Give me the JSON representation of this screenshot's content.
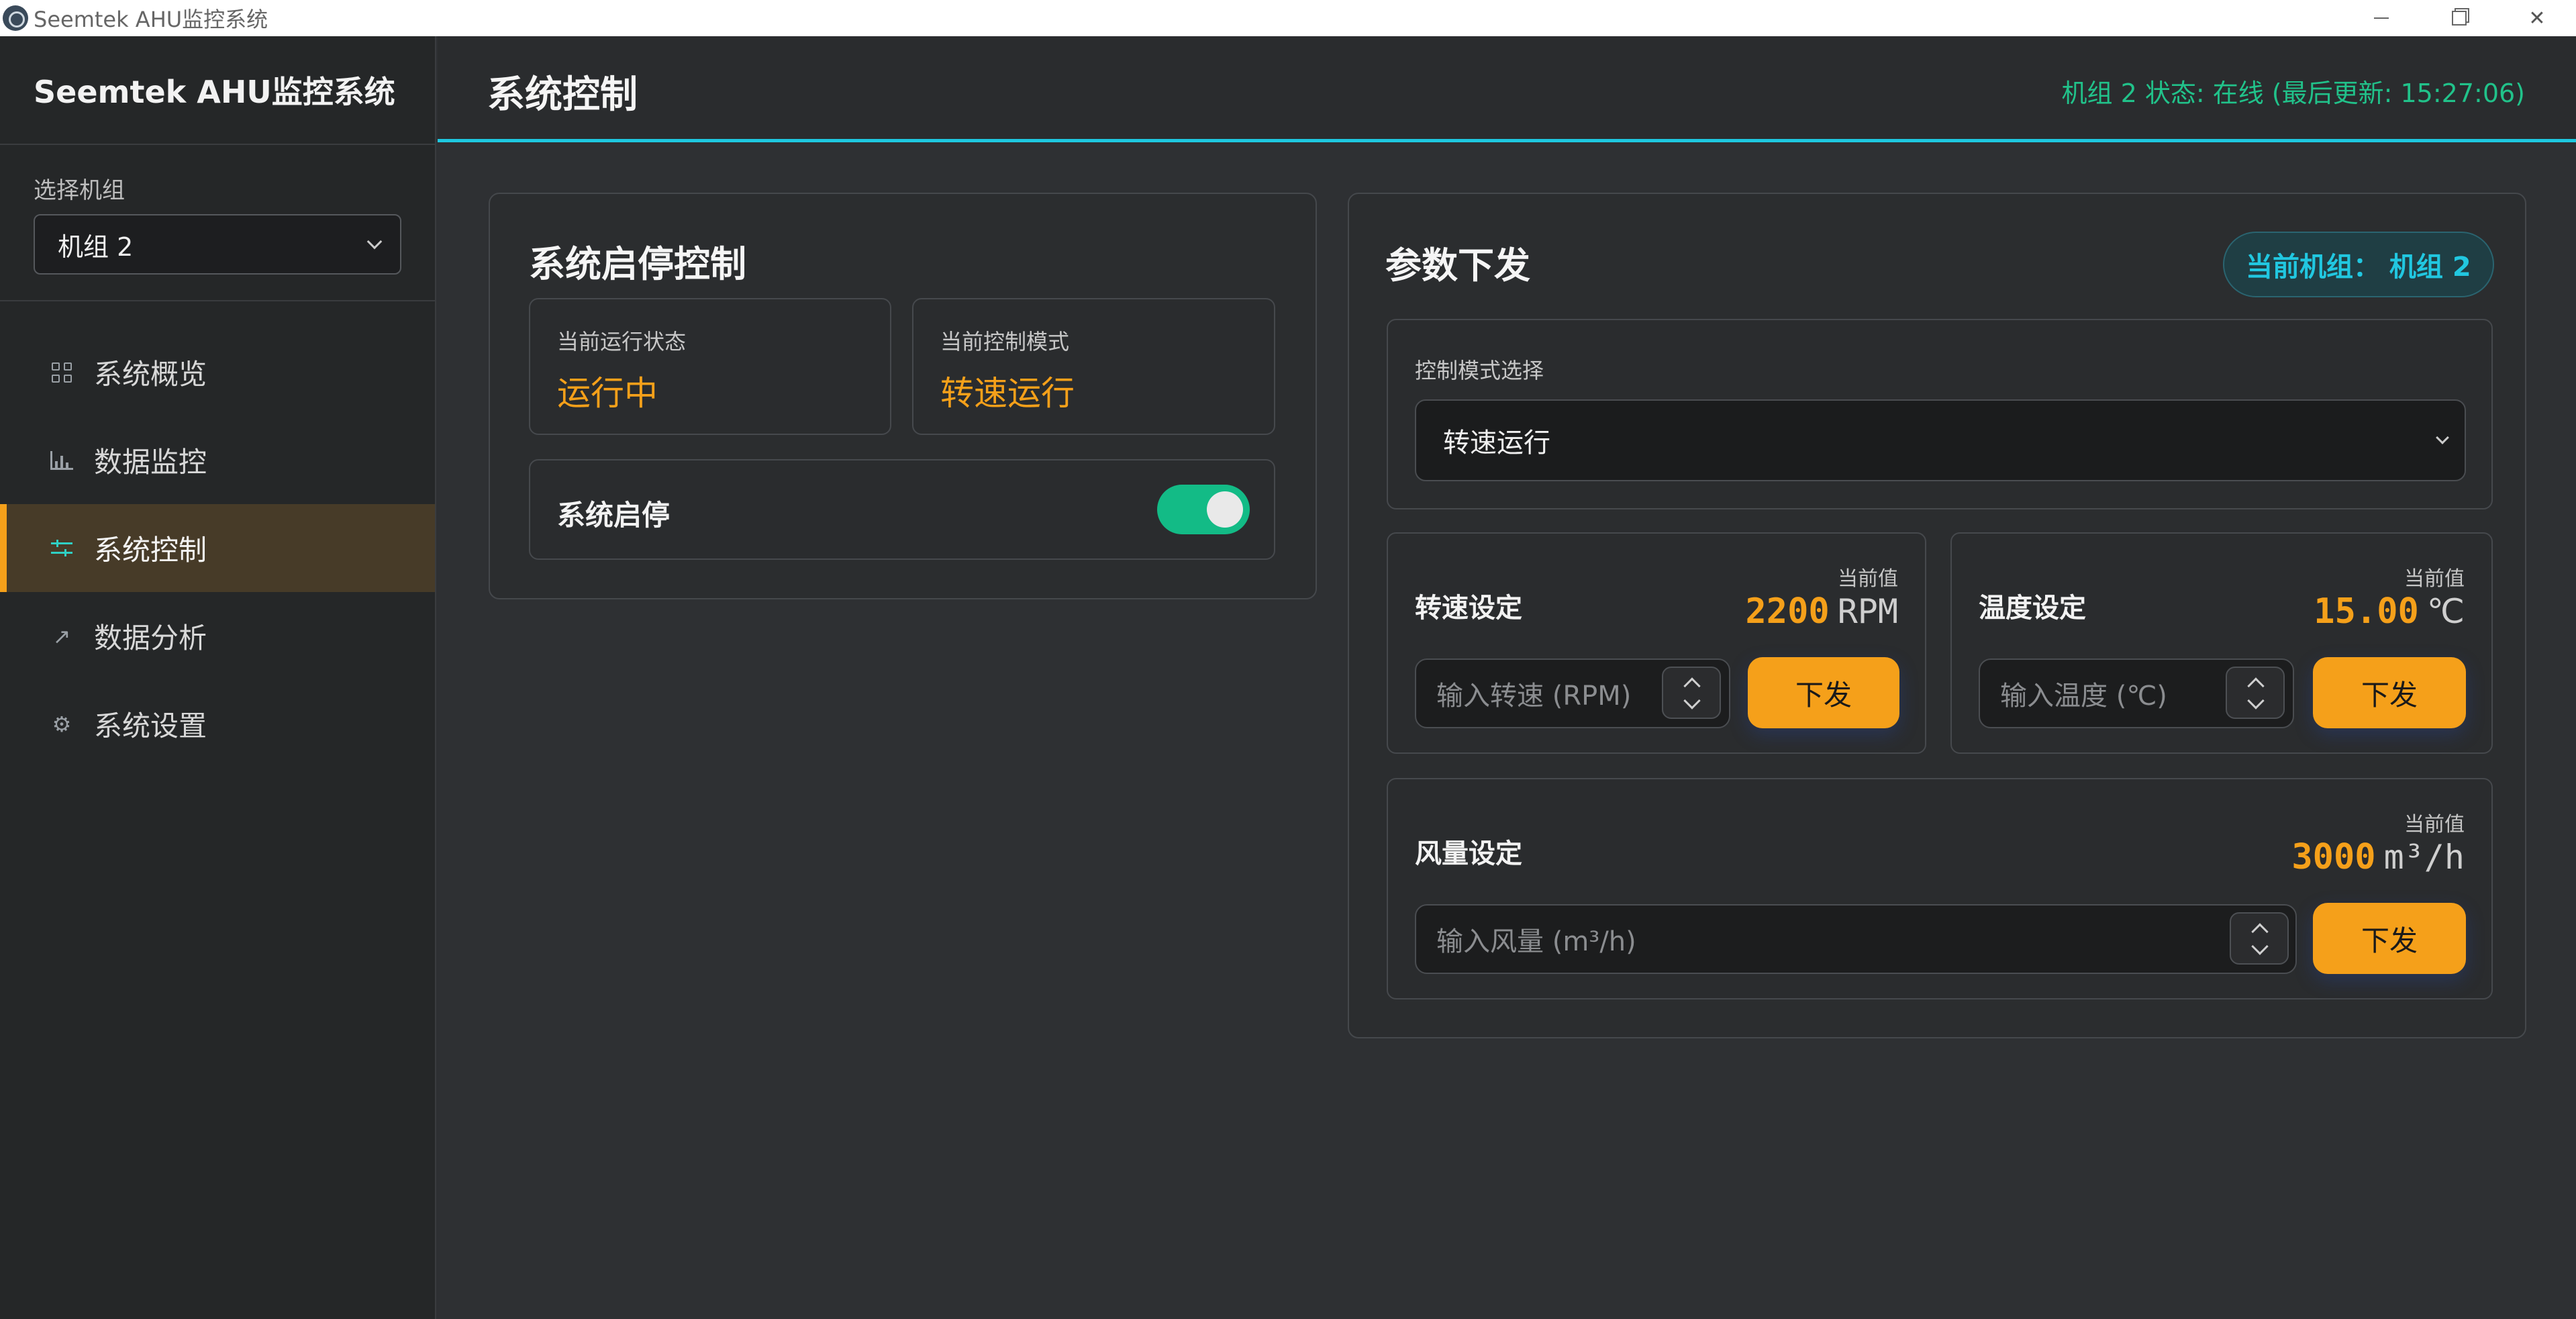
{
  "window": {
    "title": "Seemtek AHU监控系统"
  },
  "sidebar": {
    "brand": "Seemtek AHU监控系统",
    "unit_label": "选择机组",
    "unit_selected": "机组 2",
    "items": [
      {
        "label": "系统概览",
        "icon": "grid-icon"
      },
      {
        "label": "数据监控",
        "icon": "bar-chart-icon"
      },
      {
        "label": "系统控制",
        "icon": "sliders-icon",
        "active": true
      },
      {
        "label": "数据分析",
        "icon": "trend-icon"
      },
      {
        "label": "系统设置",
        "icon": "gear-icon"
      }
    ]
  },
  "header": {
    "title": "系统控制",
    "status": "机组 2 状态: 在线 (最后更新: 15:27:06)"
  },
  "start_stop": {
    "title": "系统启停控制",
    "status_label": "当前运行状态",
    "status_value": "运行中",
    "mode_label": "当前控制模式",
    "mode_value": "转速运行",
    "toggle_label": "系统启停",
    "toggle_on": true
  },
  "params": {
    "title": "参数下发",
    "badge": "当前机组： 机组 2",
    "mode_select_label": "控制模式选择",
    "mode_select_value": "转速运行",
    "current_label": "当前值",
    "send_label": "下发",
    "speed": {
      "title": "转速设定",
      "value": "2200",
      "unit": "RPM",
      "placeholder": "输入转速 (RPM)"
    },
    "temp": {
      "title": "温度设定",
      "value": "15.00",
      "unit": "℃",
      "placeholder": "输入温度 (℃)"
    },
    "airflow": {
      "title": "风量设定",
      "value": "3000",
      "unit": "m³/h",
      "placeholder": "输入风量 (m³/h)"
    }
  },
  "colors": {
    "accent": "#f5a01a",
    "teal": "#1ec8e0",
    "online": "#21c28a",
    "toggle": "#13bb86"
  }
}
